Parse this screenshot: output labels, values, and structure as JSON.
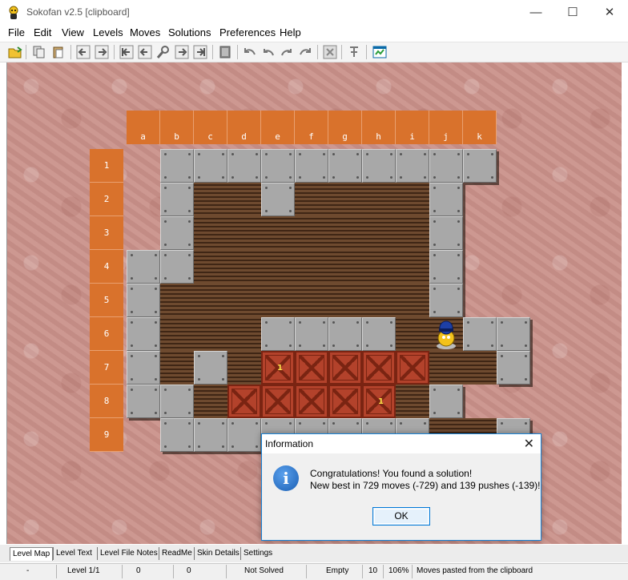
{
  "window": {
    "title": "Sokofan v2.5 [clipboard]",
    "minimize": "—",
    "maximize": "☐",
    "close": "✕"
  },
  "menu": [
    "File",
    "Edit",
    "View",
    "Levels",
    "Moves",
    "Solutions",
    "Preferences",
    "Help"
  ],
  "toolbar_icons": [
    "open-folder-icon",
    "copy-icon",
    "paste-icon",
    "previous-level-icon",
    "next-level-icon",
    "first-level-icon",
    "back-level-icon",
    "search-level-icon",
    "forward-level-icon",
    "last-level-icon",
    "clipboard-icon",
    "undo-all-icon",
    "undo-icon",
    "redo-icon",
    "redo-all-icon",
    "stop-icon",
    "solver-icon",
    "skin-window-icon"
  ],
  "board": {
    "columns": [
      "a",
      "b",
      "c",
      "d",
      "e",
      "f",
      "g",
      "h",
      "i",
      "j",
      "k"
    ],
    "rows": [
      "1",
      "2",
      "3",
      "4",
      "5",
      "6",
      "7",
      "8",
      "9"
    ],
    "map": [
      " ##########",
      " #  #    # ",
      " #       # ",
      "##       # ",
      "#        # ",
      "#   #### @##",
      "# # *****  #",
      "## ***** #",
      " ########  #"
    ],
    "box_labels": [
      {
        "row": 7,
        "col": "e",
        "label": "1"
      },
      {
        "row": 8,
        "col": "h",
        "label": "1"
      }
    ]
  },
  "dialog": {
    "title": "Information",
    "close": "✕",
    "icon": "info-icon",
    "icon_glyph": "i",
    "line1": "Congratulations! You found a solution!",
    "line2": "New best in 729 moves (-729) and 139 pushes (-139)!",
    "ok": "OK"
  },
  "tabs": [
    "Level Map",
    "Level Text",
    "Level File Notes",
    "ReadMe",
    "Skin Details",
    "Settings"
  ],
  "status": {
    "dash": "-",
    "level": "Level 1/1",
    "moves": "0",
    "pushes": "0",
    "solved": "Not Solved",
    "empty": "Empty",
    "count": "10",
    "zoom": "106%",
    "message": "Moves pasted from the clipboard"
  }
}
